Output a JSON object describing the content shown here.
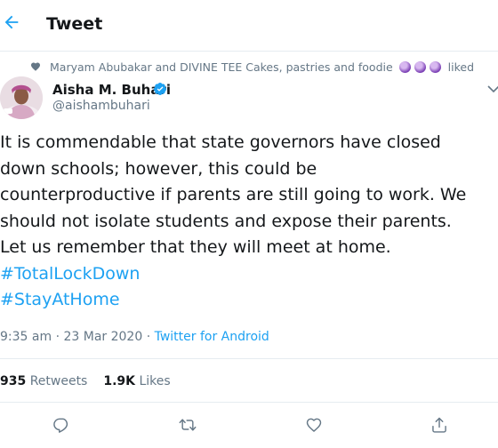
{
  "header": {
    "title": "Tweet"
  },
  "social_context": {
    "text": "Maryam Abubakar and DIVINE TEE Cakes, pastries and foodie",
    "suffix": "liked"
  },
  "author": {
    "name": "Aisha M. Buhari",
    "handle": "@aishambuhari"
  },
  "tweet": {
    "lines": [
      "It is commendable that state governors have closed",
      "down schools; however, this could be",
      "counterproductive if parents are still going to work. We",
      "should not isolate students and expose their parents.",
      "Let us remember that they will meet at home."
    ],
    "hashtags": [
      "#TotalLockDown",
      "#StayAtHome"
    ]
  },
  "meta": {
    "time": "9:35 am",
    "date": "23 Mar 2020",
    "separator": "·",
    "source": "Twitter for Android"
  },
  "stats": {
    "retweets_count": "935",
    "retweets_label": "Retweets",
    "likes_count": "1.9K",
    "likes_label": "Likes"
  },
  "colors": {
    "accent": "#1da1f2",
    "text": "#14171a",
    "muted": "#657786",
    "border": "#e6ecf0"
  },
  "icons": {
    "back": "arrow-left-icon",
    "verified": "verified-badge-icon",
    "caret": "chevron-down-icon",
    "social_heart": "heart-icon",
    "reply": "reply-icon",
    "retweet": "retweet-icon",
    "like": "like-icon",
    "share": "share-icon"
  }
}
